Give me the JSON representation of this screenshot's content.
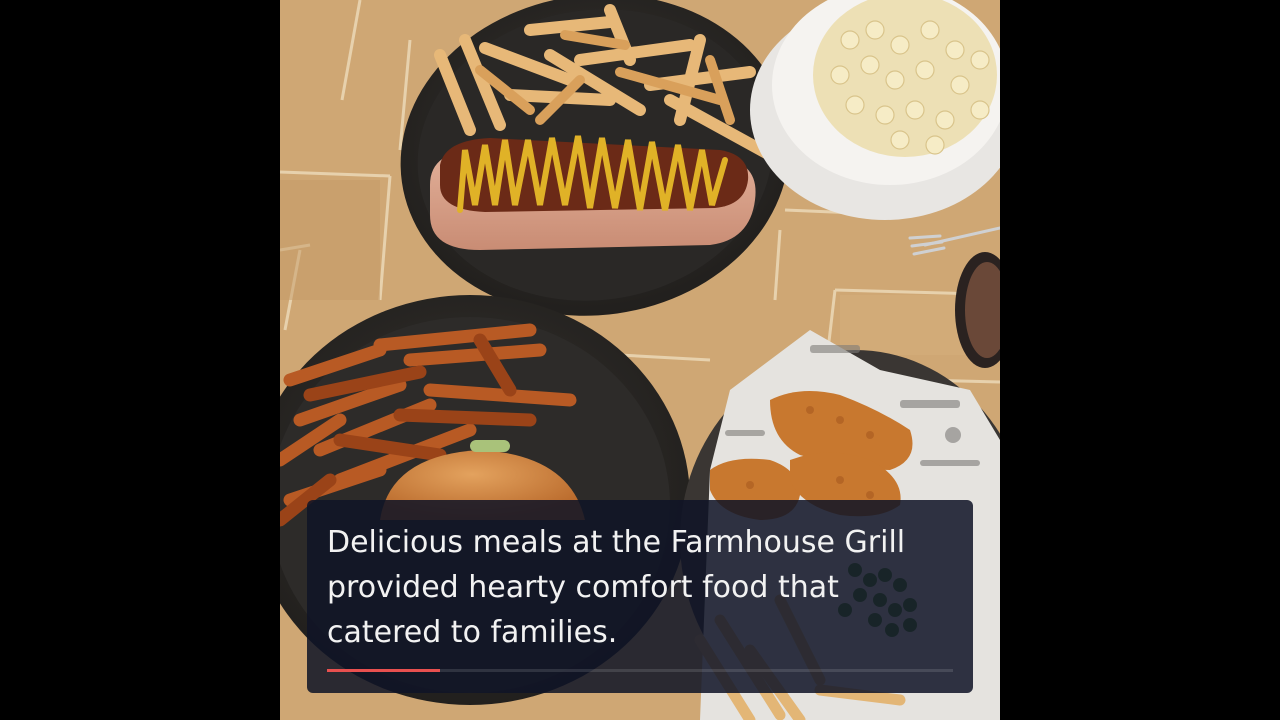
{
  "caption": {
    "lines": [
      "Delicious meals at the Farmhouse Grill",
      "provided hearty comfort food that",
      "catered to families."
    ]
  },
  "progress": {
    "fraction": 0.18,
    "color": "#e8504f"
  }
}
